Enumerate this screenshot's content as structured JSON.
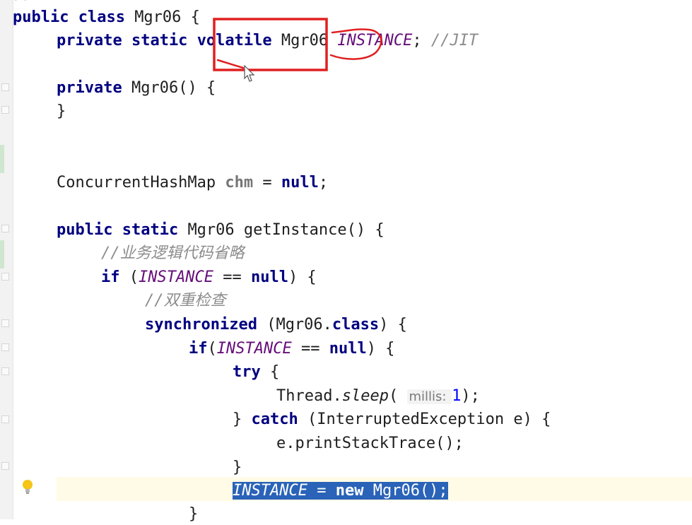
{
  "editor": {
    "top_partial": "//",
    "lines": [
      {
        "id": "class-decl",
        "parts": [
          {
            "t": "public class ",
            "c": "kw"
          },
          {
            "t": "Mgr06 {",
            "c": "tx"
          }
        ]
      },
      {
        "id": "instance-field",
        "parts": [
          {
            "t": "private static ",
            "c": "kw"
          },
          {
            "t": "volatile",
            "c": "kw"
          },
          {
            "t": " Mgr06 ",
            "c": "tx"
          },
          {
            "t": "INSTANCE",
            "c": "sf"
          },
          {
            "t": "; ",
            "c": "tx"
          },
          {
            "t": "//JIT",
            "c": "cm"
          }
        ]
      },
      {
        "id": "ctor-decl",
        "parts": [
          {
            "t": "private ",
            "c": "kw"
          },
          {
            "t": "Mgr06() {",
            "c": "tx"
          }
        ]
      },
      {
        "id": "ctor-close",
        "parts": [
          {
            "t": "}",
            "c": "tx"
          }
        ]
      },
      {
        "id": "chm-field",
        "parts": [
          {
            "t": "ConcurrentHashMap ",
            "c": "tx"
          },
          {
            "t": "chm",
            "c": "hint-var"
          },
          {
            "t": " = ",
            "c": "tx"
          },
          {
            "t": "null",
            "c": "kw"
          },
          {
            "t": ";",
            "c": "tx"
          }
        ]
      },
      {
        "id": "getinstance-decl",
        "parts": [
          {
            "t": "public static ",
            "c": "kw"
          },
          {
            "t": "Mgr06 getInstance() {",
            "c": "tx"
          }
        ]
      },
      {
        "id": "comment-business",
        "parts": [
          {
            "t": "//业务逻辑代码省略",
            "c": "cm"
          }
        ]
      },
      {
        "id": "if-outer",
        "parts": [
          {
            "t": "if",
            "c": "kw"
          },
          {
            "t": " (",
            "c": "tx"
          },
          {
            "t": "INSTANCE",
            "c": "sf"
          },
          {
            "t": " == ",
            "c": "tx"
          },
          {
            "t": "null",
            "c": "kw"
          },
          {
            "t": ") {",
            "c": "tx"
          }
        ]
      },
      {
        "id": "comment-double-check",
        "parts": [
          {
            "t": "//双重检查",
            "c": "cm"
          }
        ]
      },
      {
        "id": "synchronized",
        "parts": [
          {
            "t": "synchronized",
            "c": "kw"
          },
          {
            "t": " (Mgr06.",
            "c": "tx"
          },
          {
            "t": "class",
            "c": "kw"
          },
          {
            "t": ") {",
            "c": "tx"
          }
        ]
      },
      {
        "id": "if-inner",
        "parts": [
          {
            "t": "if",
            "c": "kw"
          },
          {
            "t": "(",
            "c": "tx"
          },
          {
            "t": "INSTANCE",
            "c": "sf"
          },
          {
            "t": " == ",
            "c": "tx"
          },
          {
            "t": "null",
            "c": "kw"
          },
          {
            "t": ") {",
            "c": "tx"
          }
        ]
      },
      {
        "id": "try",
        "parts": [
          {
            "t": "try",
            "c": "kw"
          },
          {
            "t": " {",
            "c": "tx"
          }
        ]
      },
      {
        "id": "thread-sleep",
        "parts": [
          {
            "t": "Thread.",
            "c": "tx"
          },
          {
            "t": "sleep",
            "c": "it"
          },
          {
            "t": "( ",
            "c": "tx"
          },
          {
            "t": "millis: ",
            "c": "hint"
          },
          {
            "t": "1",
            "c": "num"
          },
          {
            "t": ");",
            "c": "tx"
          }
        ]
      },
      {
        "id": "catch",
        "parts": [
          {
            "t": "} ",
            "c": "tx"
          },
          {
            "t": "catch",
            "c": "kw"
          },
          {
            "t": " (InterruptedException e) {",
            "c": "tx"
          }
        ]
      },
      {
        "id": "print-stack",
        "parts": [
          {
            "t": "e.printStackTrace();",
            "c": "tx"
          }
        ]
      },
      {
        "id": "catch-close",
        "parts": [
          {
            "t": "}",
            "c": "tx"
          }
        ]
      },
      {
        "id": "assign-instance",
        "selected": true,
        "parts": [
          {
            "t": "INSTANCE",
            "c": "sf"
          },
          {
            "t": " = ",
            "c": "tx"
          },
          {
            "t": "new",
            "c": "kw"
          },
          {
            "t": " Mgr06();",
            "c": "tx"
          }
        ]
      },
      {
        "id": "sync-close",
        "parts": [
          {
            "t": "}",
            "c": "tx"
          }
        ]
      }
    ]
  },
  "annotation": {
    "box_color": "#e02020",
    "ink_color": "#e02020"
  }
}
